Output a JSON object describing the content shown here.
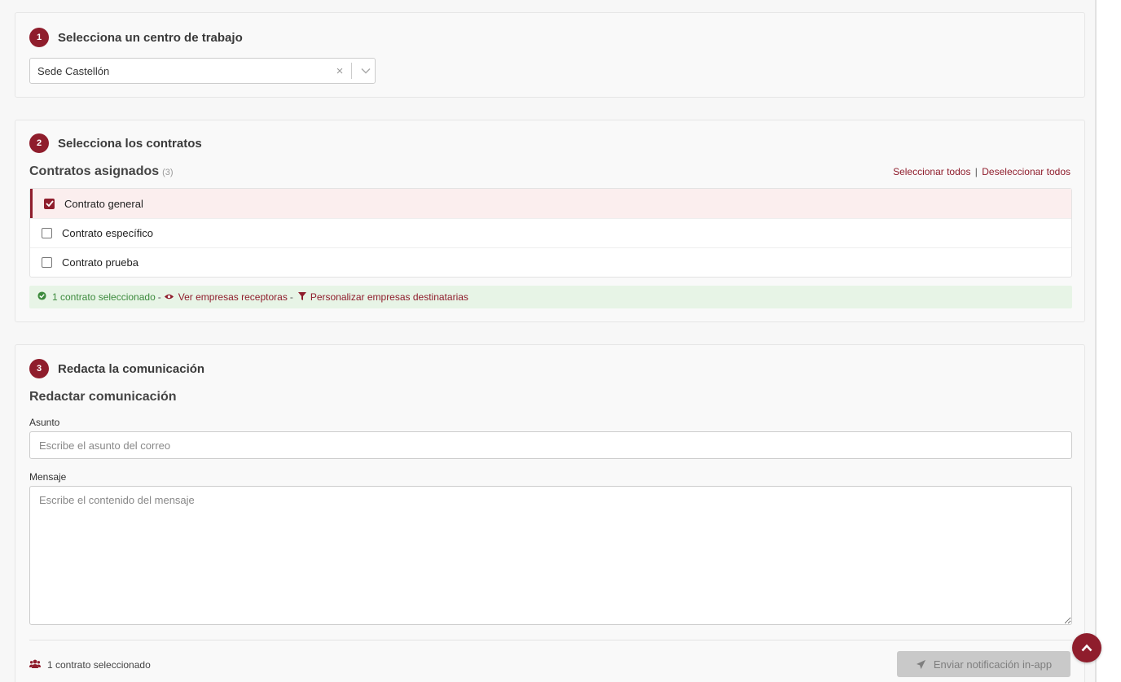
{
  "colors": {
    "accent": "#8f1d2c",
    "success_bg": "#e7f4e6",
    "success_text": "#3c8a3c"
  },
  "step1": {
    "number": "1",
    "title": "Selecciona un centro de trabajo",
    "select_value": "Sede Castellón",
    "clear_symbol": "×"
  },
  "step2": {
    "number": "2",
    "title": "Selecciona los contratos",
    "subtitle": "Contratos asignados",
    "count": "(3)",
    "select_all": "Seleccionar todos",
    "separator": "|",
    "deselect_all": "Deseleccionar todos",
    "contracts": [
      {
        "label": "Contrato general",
        "checked": true
      },
      {
        "label": "Contrato específico",
        "checked": false
      },
      {
        "label": "Contrato prueba",
        "checked": false
      }
    ],
    "status": {
      "selected_text": "1 contrato seleccionado",
      "dash": "-",
      "view_link": "Ver empresas receptoras",
      "customize_link": "Personalizar empresas destinatarias"
    }
  },
  "step3": {
    "number": "3",
    "title": "Redacta la comunicación",
    "subtitle": "Redactar comunicación",
    "subject_label": "Asunto",
    "subject_placeholder": "Escribe el asunto del correo",
    "message_label": "Mensaje",
    "message_placeholder": "Escribe el contenido del mensaje",
    "footer_count": "1 contrato seleccionado",
    "send_button": "Enviar notificación in-app"
  },
  "icons": {
    "check_circle": "check-circle-icon",
    "eye": "eye-icon",
    "filter": "filter-icon",
    "users": "users-icon",
    "send": "paper-plane-icon",
    "scroll_top": "chevron-up-icon"
  }
}
